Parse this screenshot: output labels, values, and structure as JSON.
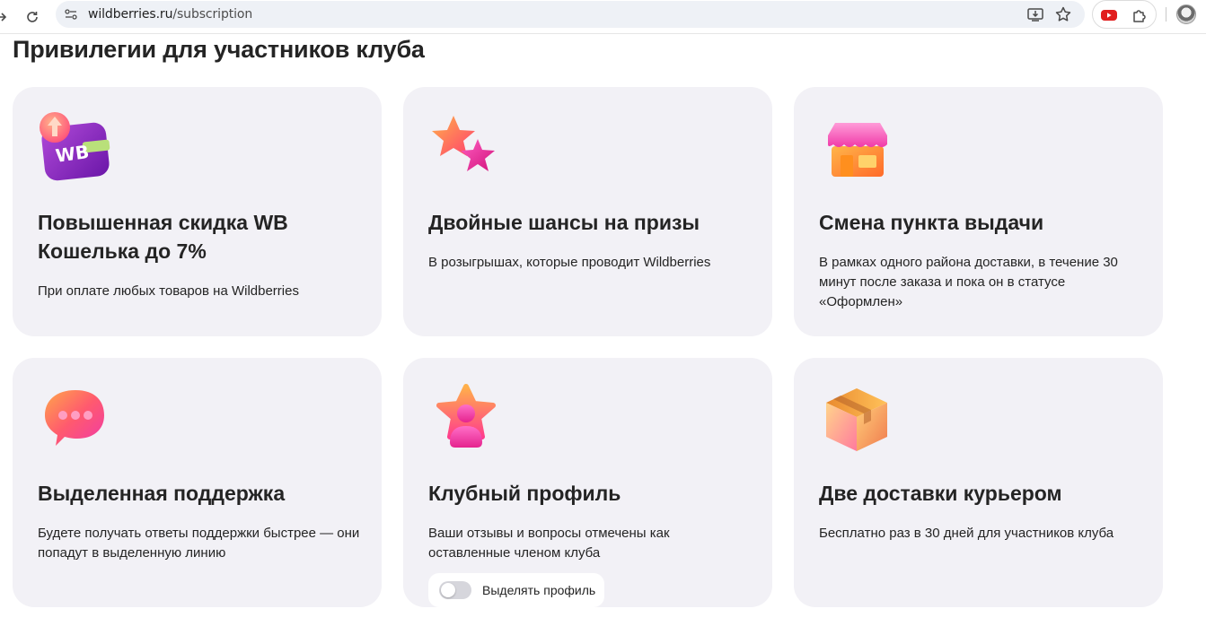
{
  "browser": {
    "url_host": "wildberries.ru",
    "url_path": "/subscription"
  },
  "page": {
    "title": "Привилегии для участников клуба"
  },
  "cards": [
    {
      "title": "Повышенная скидка WB Кошелька до 7%",
      "text": "При оплате любых товаров на Wildberries",
      "illustration": "wb-wallet-icon",
      "illus_label": "WB"
    },
    {
      "title": "Двойные шансы на призы",
      "text": "В розыгрышах, которые проводит Wildberries",
      "illustration": "stars-icon"
    },
    {
      "title": "Смена пункта выдачи",
      "text": "В рамках одного района доставки, в течение 30 минут после заказа и пока он в статусе «Оформлен»",
      "illustration": "store-icon"
    },
    {
      "title": "Выделенная поддержка",
      "text": "Будете получать ответы поддержки быстрее — они попадут в выделенную линию",
      "illustration": "chat-bubble-icon"
    },
    {
      "title": "Клубный профиль",
      "text": "Ваши отзывы и вопросы отмечены как оставленные членом клуба",
      "illustration": "star-profile-icon",
      "toggle": {
        "label": "Выделять профиль",
        "on": false
      }
    },
    {
      "title": "Две доставки курьером",
      "text": "Бесплатно раз в 30 дней для участников клуба",
      "illustration": "box-icon"
    }
  ],
  "colors": {
    "card_bg": "#f2f1f6",
    "text": "#242424",
    "accent_pink": "#e8308c",
    "accent_orange": "#ff8a2a",
    "accent_purple": "#8a2be2"
  }
}
